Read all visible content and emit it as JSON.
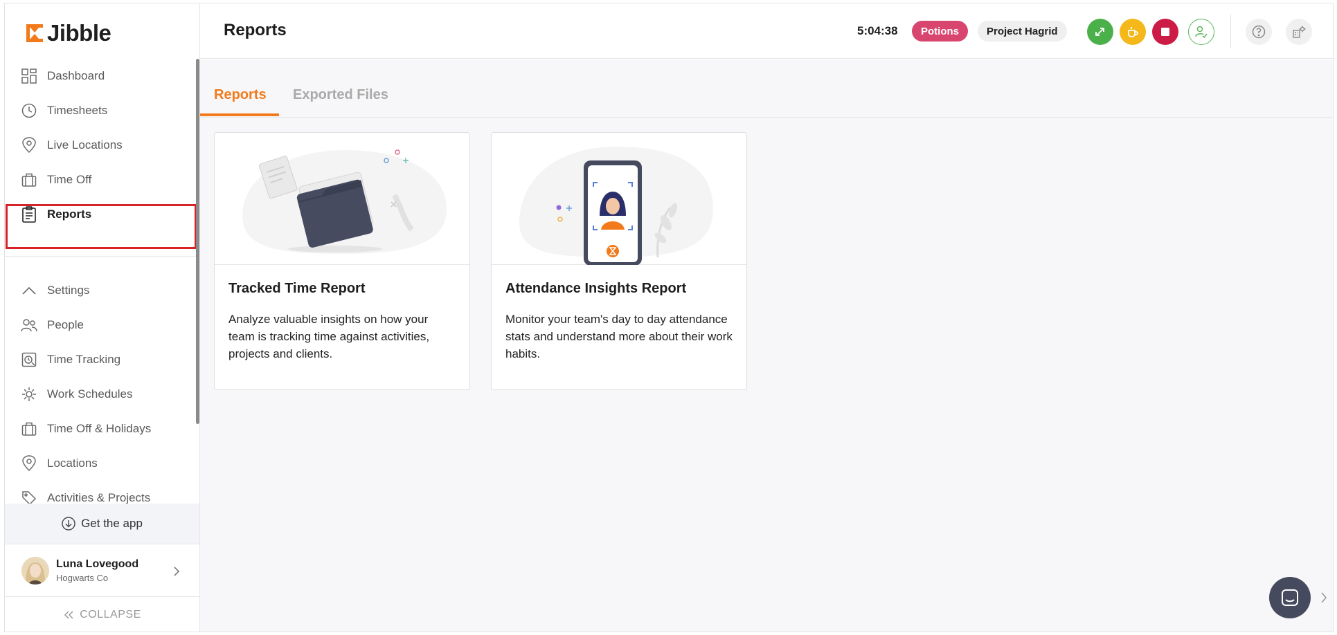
{
  "app": {
    "brand": "Jibble",
    "brand_color": "#f27a1a"
  },
  "sidebar": {
    "items": [
      {
        "label": "Dashboard",
        "icon": "dashboard-icon"
      },
      {
        "label": "Timesheets",
        "icon": "clock-icon"
      },
      {
        "label": "Live Locations",
        "icon": "location-pin-icon"
      },
      {
        "label": "Time Off",
        "icon": "suitcase-icon"
      },
      {
        "label": "Reports",
        "icon": "clipboard-icon",
        "active": true
      }
    ],
    "settings_label": "Settings",
    "settings_items": [
      {
        "label": "People",
        "icon": "people-icon"
      },
      {
        "label": "Time Tracking",
        "icon": "time-tracking-icon"
      },
      {
        "label": "Work Schedules",
        "icon": "work-schedule-icon"
      },
      {
        "label": "Time Off & Holidays",
        "icon": "suitcase-icon"
      },
      {
        "label": "Locations",
        "icon": "location-pin-icon"
      },
      {
        "label": "Activities & Projects",
        "icon": "tag-icon"
      }
    ],
    "get_app": "Get the app",
    "user": {
      "name": "Luna Lovegood",
      "org": "Hogwarts Co"
    },
    "collapse": "COLLAPSE"
  },
  "header": {
    "title": "Reports",
    "timer": "5:04:38",
    "activity_chip": "Potions",
    "project_chip": "Project Hagrid"
  },
  "tabs": [
    {
      "label": "Reports",
      "active": true
    },
    {
      "label": "Exported Files",
      "active": false
    }
  ],
  "cards": [
    {
      "title": "Tracked Time Report",
      "description": "Analyze valuable insights on how your team is tracking time against activities, projects and clients."
    },
    {
      "title": "Attendance Insights Report",
      "description": "Monitor your team's day to day attendance stats and understand more about their work habits."
    }
  ]
}
